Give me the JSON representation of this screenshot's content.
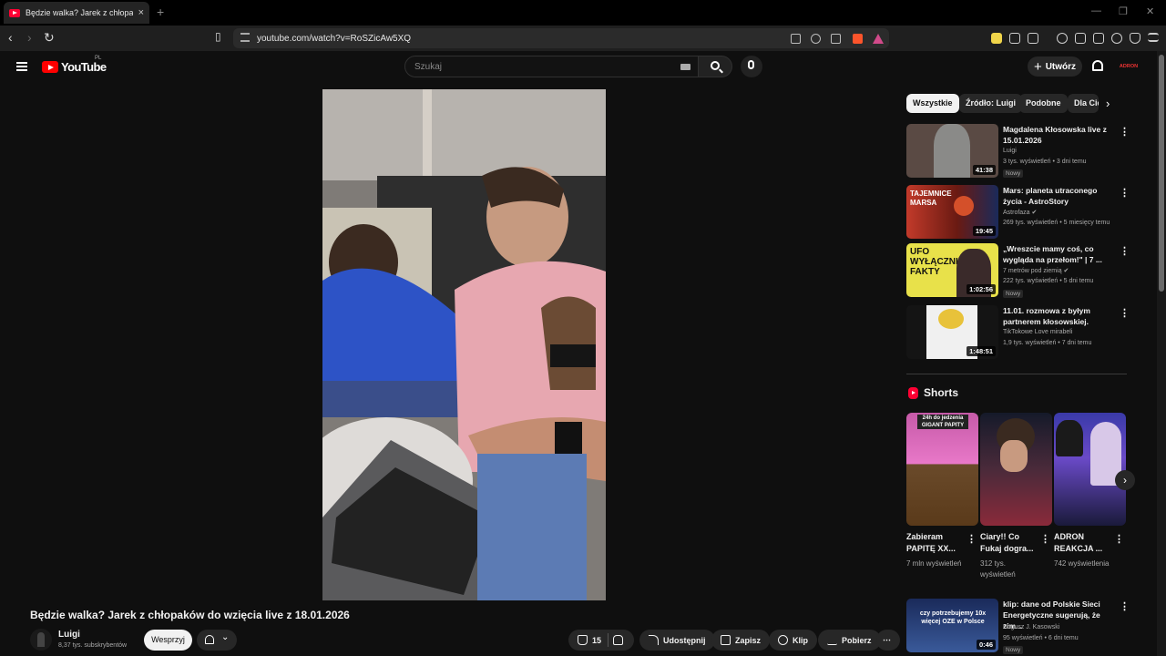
{
  "browser": {
    "tab_title": "Będzie walka? Jarek z chłopaków",
    "tab_close": "×",
    "new_tab": "+",
    "url": "youtube.com/watch?v=RoSZicAw5XQ",
    "window_controls": [
      "—",
      "❐",
      "✕"
    ]
  },
  "header": {
    "logo_text": "YouTube",
    "country_code": "PL",
    "search_placeholder": "Szukaj",
    "create_label": "Utwórz",
    "avatar_text": "ADRON"
  },
  "video": {
    "title": "Będzie walka? Jarek z chłopaków do wzięcia live z 18.01.2026",
    "channel_name": "Luigi",
    "channel_subs": "8,37 tys. subskrybentów",
    "join_label": "Wesprzyj",
    "like_count": "15",
    "share_label": "Udostępnij",
    "save_label": "Zapisz",
    "clip_label": "Klip",
    "download_label": "Pobierz",
    "more_label": "⋯"
  },
  "chips": [
    "Wszystkie",
    "Źródło: Luigi",
    "Podobne",
    "Dla Ciebie"
  ],
  "recommended": [
    {
      "title": "Magdalena Kłosowska live z 15.01.2026",
      "channel": "Luigi",
      "meta": "3 tys. wyświetleń • 3 dni temu",
      "badge": "Nowy",
      "duration": "41:38",
      "thumb_color": "#5a4a44"
    },
    {
      "title": "Mars: planeta utraconego życia - AstroStory",
      "channel": "Astrofaza ✔",
      "meta": "269 tys. wyświetleń • 5 miesięcy temu",
      "badge": "",
      "duration": "19:45",
      "thumb_color": "#8a2a22",
      "thumb_text": "TAJEMNICE MARSA"
    },
    {
      "title": "„Wreszcie mamy coś, co wygląda na przełom!\" | 7 ...",
      "channel": "7 metrów pod ziemią ✔",
      "meta": "222 tys. wyświetleń • 5 dni temu",
      "badge": "Nowy",
      "duration": "1:02:56",
      "thumb_color": "#e8e14a",
      "thumb_text": "UFO WYŁĄCZNIE FAKTY"
    },
    {
      "title": "11.01. rozmowa z byłym partnerem kłosowskiej.",
      "channel": "TikTokowe Love mirabeli",
      "meta": "1,9 tys. wyświetleń • 7 dni temu",
      "badge": "",
      "duration": "1:48:51",
      "thumb_color": "#1a1a1a"
    },
    {
      "title": "klip: dane od Polskie Sieci Energetyczne sugerują, że zim...",
      "channel": "Bogusz J. Kasowski",
      "meta": "95 wyświetleń • 6 dni temu",
      "badge": "Nowy",
      "duration": "0:46",
      "thumb_color": "#243a6a",
      "thumb_text": "czy potrzebujemy 10x więcej OZE w Polsce"
    }
  ],
  "shorts": {
    "heading": "Shorts",
    "items": [
      {
        "title": "Zabieram PAPITĘ XX...",
        "views": "7 mln wyświetleń",
        "color": "#d868b6",
        "caption": "24h do jedzenia GIGANT PAPITY"
      },
      {
        "title": "Ciary!! Co Fukaj dogra...",
        "views": "312 tys. wyświetleń",
        "color": "#5a2a3a",
        "caption": ""
      },
      {
        "title": "ADRON REAKCJA ...",
        "views": "742 wyświetlenia",
        "color": "#2a3a8a",
        "caption": ""
      }
    ]
  },
  "icons": {
    "kebab": "⋮",
    "chevron_right": "›",
    "chevron_down": "⌄"
  },
  "colors": {
    "brand_red": "#ff0000",
    "background": "#0f0f0f"
  }
}
